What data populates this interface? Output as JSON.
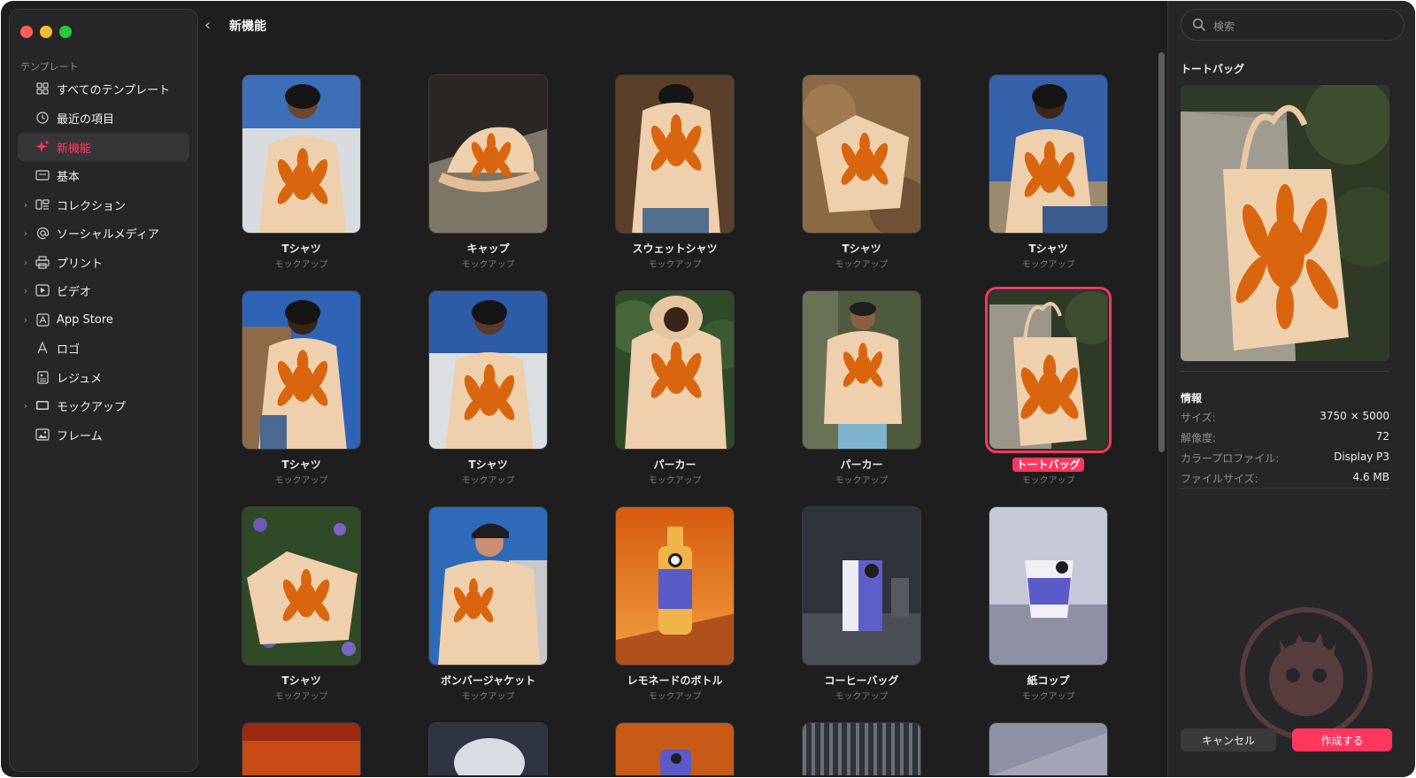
{
  "sidebar": {
    "section": "テンプレート",
    "items": [
      {
        "label": "すべてのテンプレート",
        "icon": "grid-icon",
        "chevron": false,
        "active": false
      },
      {
        "label": "最近の項目",
        "icon": "clock-icon",
        "chevron": false,
        "active": false
      },
      {
        "label": "新機能",
        "icon": "sparkles-icon",
        "chevron": false,
        "active": true
      },
      {
        "label": "基本",
        "icon": "rectangle-icon",
        "chevron": false,
        "active": false
      },
      {
        "label": "コレクション",
        "icon": "collection-icon",
        "chevron": true,
        "active": false
      },
      {
        "label": "ソーシャルメディア",
        "icon": "at-icon",
        "chevron": true,
        "active": false
      },
      {
        "label": "プリント",
        "icon": "printer-icon",
        "chevron": true,
        "active": false
      },
      {
        "label": "ビデオ",
        "icon": "play-icon",
        "chevron": true,
        "active": false
      },
      {
        "label": "App Store",
        "icon": "app-store-icon",
        "chevron": true,
        "active": false
      },
      {
        "label": "ロゴ",
        "icon": "logo-a-icon",
        "chevron": false,
        "active": false
      },
      {
        "label": "レジュメ",
        "icon": "document-icon",
        "chevron": false,
        "active": false
      },
      {
        "label": "モックアップ",
        "icon": "display-icon",
        "chevron": true,
        "active": false
      },
      {
        "label": "フレーム",
        "icon": "photo-icon",
        "chevron": false,
        "active": false
      }
    ]
  },
  "header": {
    "title": "新機能"
  },
  "grid": {
    "items": [
      {
        "name": "Tシャツ",
        "sub": "モックアップ",
        "thumb": "tshirt-woman"
      },
      {
        "name": "キャップ",
        "sub": "モックアップ",
        "thumb": "cap"
      },
      {
        "name": "スウェットシャツ",
        "sub": "モックアップ",
        "thumb": "sweatshirt"
      },
      {
        "name": "Tシャツ",
        "sub": "モックアップ",
        "thumb": "tshirt-rock"
      },
      {
        "name": "Tシャツ",
        "sub": "モックアップ",
        "thumb": "tshirt-man"
      },
      {
        "name": "Tシャツ",
        "sub": "モックアップ",
        "thumb": "tshirt-back-man"
      },
      {
        "name": "Tシャツ",
        "sub": "モックアップ",
        "thumb": "tshirt-back-woman"
      },
      {
        "name": "パーカー",
        "sub": "モックアップ",
        "thumb": "hoodie-green"
      },
      {
        "name": "パーカー",
        "sub": "モックアップ",
        "thumb": "hoodie-man"
      },
      {
        "name": "トートバッグ",
        "sub": "モックアップ",
        "thumb": "tote",
        "selected": true
      },
      {
        "name": "Tシャツ",
        "sub": "モックアップ",
        "thumb": "tshirt-flowers"
      },
      {
        "name": "ボンバージャケット",
        "sub": "モックアップ",
        "thumb": "bomber"
      },
      {
        "name": "レモネードのボトル",
        "sub": "モックアップ",
        "thumb": "bottle"
      },
      {
        "name": "コーヒーバッグ",
        "sub": "モックアップ",
        "thumb": "coffee"
      },
      {
        "name": "紙コップ",
        "sub": "モックアップ",
        "thumb": "cup"
      }
    ]
  },
  "search": {
    "placeholder": "検索"
  },
  "preview": {
    "title": "トートバッグ",
    "info_title": "情報",
    "info": [
      {
        "key": "サイズ:",
        "value": "3750 × 5000"
      },
      {
        "key": "解像度:",
        "value": "72"
      },
      {
        "key": "カラープロファイル:",
        "value": "Display P3"
      },
      {
        "key": "ファイルサイズ:",
        "value": "4.6 MB"
      }
    ]
  },
  "buttons": {
    "cancel": "キャンセル",
    "create": "作成する"
  },
  "colors": {
    "accent": "#ff375f",
    "background": "#1e1e1e",
    "sidebar": "#262628",
    "print": "#d9660f"
  }
}
